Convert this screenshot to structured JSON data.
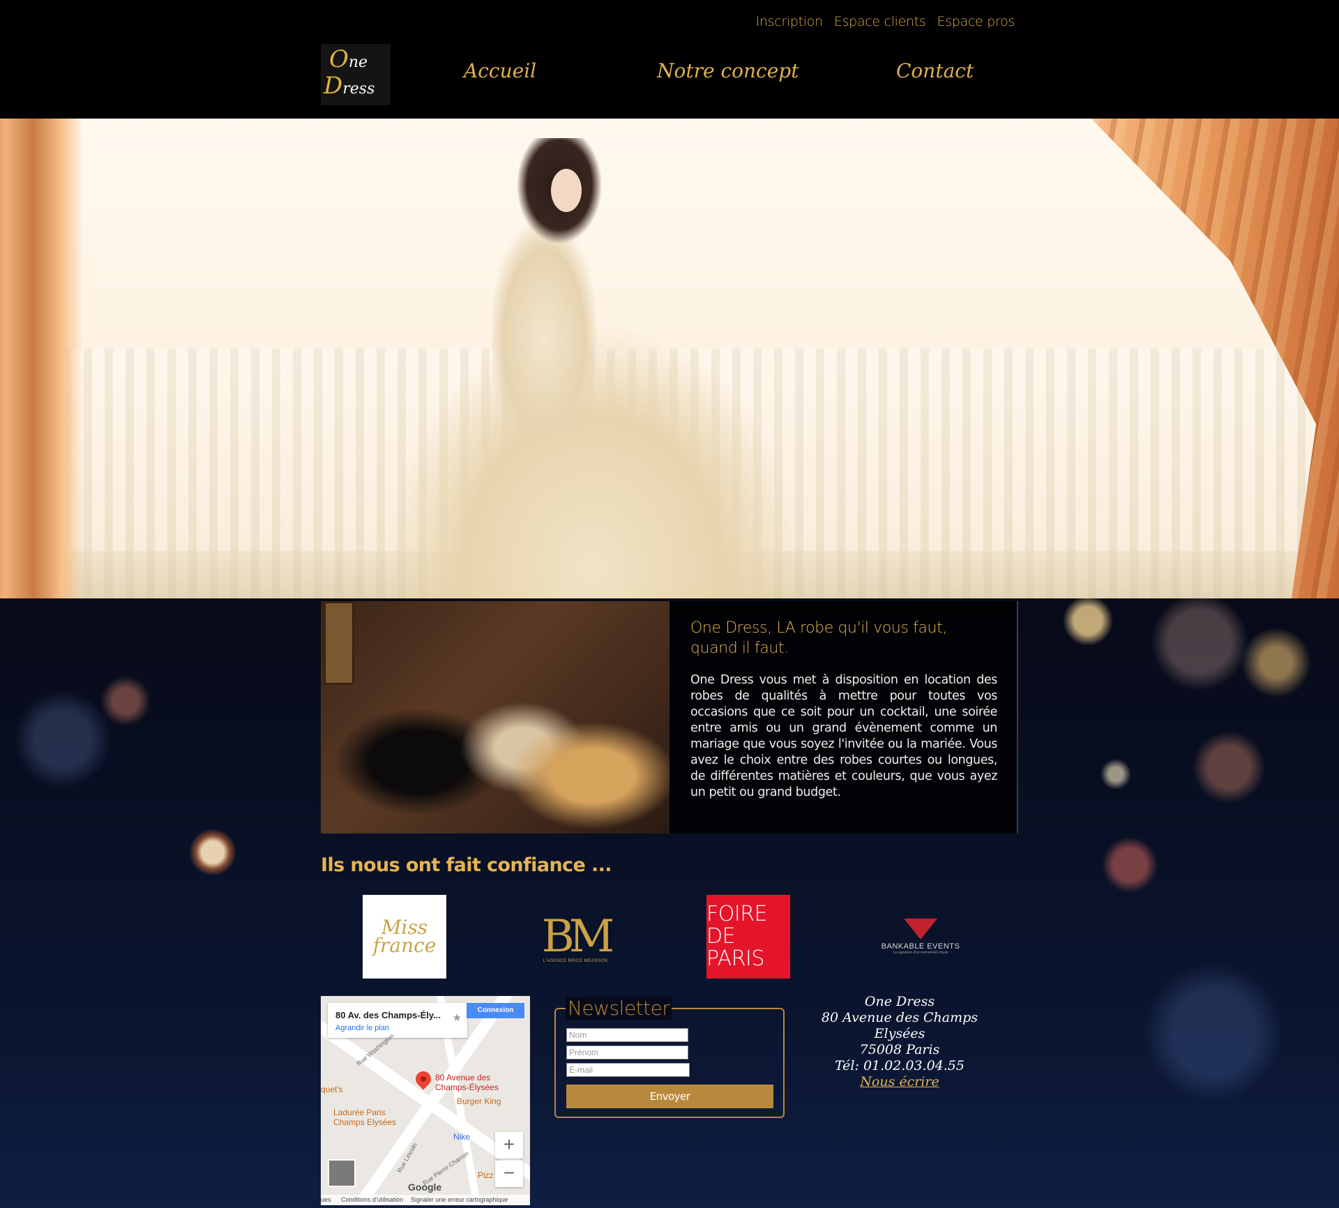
{
  "top_links": [
    "Inscription",
    "Espace clients",
    "Espace pros"
  ],
  "logo": {
    "line1_cap": "O",
    "line1_rest": "ne",
    "line2_cap": "D",
    "line2_rest": "ress"
  },
  "nav": [
    "Accueil",
    "Notre concept",
    "Contact"
  ],
  "about": {
    "title": "One Dress, LA robe qu'il vous faut, quand il faut.",
    "text": "One Dress vous met à disposition en location des robes de qualités à mettre pour toutes vos occasions que ce soit pour un cocktail, une soirée entre amis ou un grand évènement comme un mariage que vous soyez l'invitée ou la mariée. Vous avez le choix entre des robes courtes ou longues, de différentes matières et couleurs, que vous ayez un petit ou grand budget."
  },
  "trust_title": "Ils nous ont fait confiance ...",
  "partners": {
    "miss_france": "Miss france",
    "bm": "BM",
    "bm_sub": "L'AGENCE BRICE MEASSON",
    "foire": "FOIRE DE PARIS",
    "bankable": "BANKABLE EVENTS",
    "bankable_sub": "La signature d'un événement réussi"
  },
  "map": {
    "place": "80 Av. des Champs-Ély...",
    "enlarge": "Agrandir le plan",
    "connect": "Connexion",
    "pin_label": "80 Avenue des Champs-Élysées",
    "poi_burger": "Burger King",
    "poi_laduree": "Ladurée Paris Champs Elysées",
    "poi_nike": "Nike",
    "poi_pizz": "Pizz",
    "street_washington": "Rue Washington",
    "street_lincoln": "Rue Lincoln",
    "street_charron": "Rue Pierre Charron",
    "poi_quet": "quet's",
    "zoom_in": "+",
    "zoom_out": "−",
    "google": "Google",
    "terms_left": "ues",
    "terms": "Conditions d'utilisation",
    "report": "Signaler une erreur cartographique"
  },
  "newsletter": {
    "legend": "Newsletter",
    "name_placeholder": "Nom",
    "firstname_placeholder": "Prénom",
    "email_placeholder": "E-mail",
    "send": "Envoyer"
  },
  "contact": {
    "name": "One Dress",
    "street": "80 Avenue des Champs Elysées",
    "city": "75008 Paris",
    "phone": "Tél: 01.02.03.04.55",
    "write": "Nous écrire"
  },
  "colors": {
    "gold": "#e6b352",
    "newsletter_gold": "#b8893d",
    "foire_red": "#e4152a"
  }
}
